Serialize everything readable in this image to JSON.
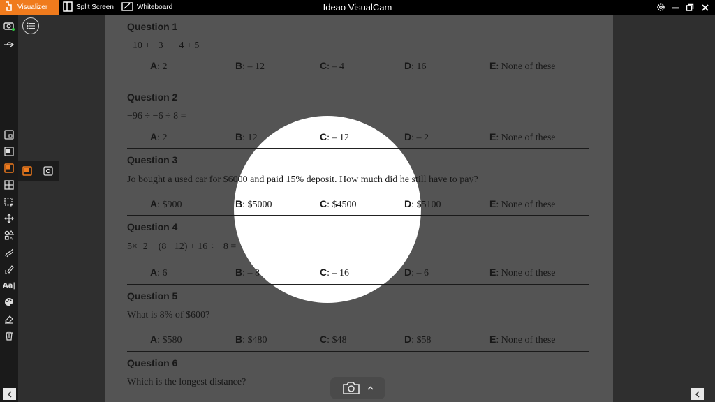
{
  "titlebar": {
    "tabs": [
      {
        "label": "Visualizer",
        "icon": "visualizer-icon",
        "active": true
      },
      {
        "label": "Split Screen",
        "icon": "split-screen-icon",
        "active": false
      },
      {
        "label": "Whiteboard",
        "icon": "whiteboard-icon",
        "active": false
      }
    ],
    "app_title": "Ideao VisualCam",
    "controls": [
      "settings-icon",
      "minimize-icon",
      "restore-icon",
      "close-icon"
    ]
  },
  "colors": {
    "accent": "#f07b1d",
    "titlebar": "#000000",
    "sidebar": "#1a1a1a",
    "stage": "#2f2f2f"
  },
  "sidebar": {
    "top": [
      "camera-icon",
      "usb-icon"
    ],
    "tools": [
      "frame-small-icon",
      "frame-full-icon",
      "spotlight-icon",
      "grid-icon",
      "select-icon",
      "move-icon",
      "shapes-icon",
      "pen-icon",
      "highlighter-icon",
      "text-icon",
      "palette-icon",
      "eraser-icon",
      "trash-icon"
    ],
    "text_tool_label": "Aa|",
    "active_tool": "spotlight-icon"
  },
  "worksheet": {
    "questions": [
      {
        "title": "Question 1",
        "text": "−10 + −3 − −4 + 5",
        "options": [
          [
            "A",
            "2"
          ],
          [
            "B",
            "– 12"
          ],
          [
            "C",
            "– 4"
          ],
          [
            "D",
            "16"
          ],
          [
            "E",
            "None of these"
          ]
        ]
      },
      {
        "title": "Question 2",
        "text": "−96 ÷ −6 ÷ 8 =",
        "options": [
          [
            "A",
            "2"
          ],
          [
            "B",
            "12"
          ],
          [
            "C",
            "– 12"
          ],
          [
            "D",
            "– 2"
          ],
          [
            "E",
            "None of these"
          ]
        ]
      },
      {
        "title": "Question 3",
        "text": "Jo bought a used car for $6000 and paid 15% deposit. How much did he still have to pay?",
        "options": [
          [
            "A",
            "$900"
          ],
          [
            "B",
            "$5000"
          ],
          [
            "C",
            "$4500"
          ],
          [
            "D",
            "$5100"
          ],
          [
            "E",
            "None of these"
          ]
        ]
      },
      {
        "title": "Question 4",
        "text": "5×−2 − (8 −12) + 16 ÷ −8 =",
        "options": [
          [
            "A",
            "6"
          ],
          [
            "B",
            "– 8"
          ],
          [
            "C",
            "– 16"
          ],
          [
            "D",
            "– 6"
          ],
          [
            "E",
            "None of these"
          ]
        ]
      },
      {
        "title": "Question 5",
        "text": "What is 8% of $600?",
        "options": [
          [
            "A",
            "$580"
          ],
          [
            "B",
            "$480"
          ],
          [
            "C",
            "$48"
          ],
          [
            "D",
            "$58"
          ],
          [
            "E",
            "None of these"
          ]
        ]
      },
      {
        "title": "Question 6",
        "text": "Which is the longest distance?",
        "options": []
      }
    ]
  },
  "bottom": {
    "capture_icon": "camera-icon",
    "expand_icon": "chevron-up-icon",
    "left_nav": "<",
    "right_nav": "<"
  }
}
